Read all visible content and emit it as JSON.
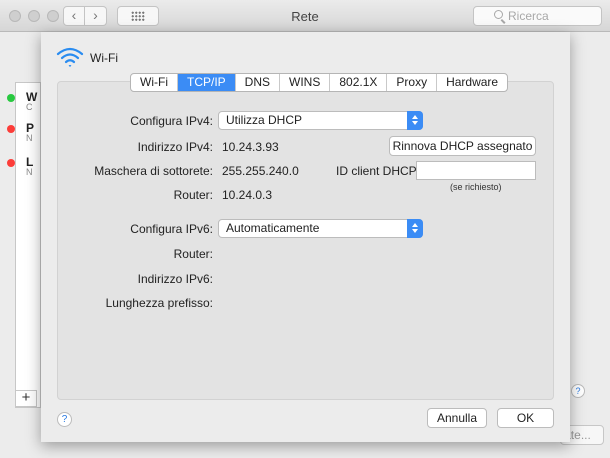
{
  "window": {
    "title": "Rete",
    "search_placeholder": "Ricerca",
    "back_label": "‹",
    "forward_label": "›"
  },
  "background": {
    "items": [
      {
        "label": "W",
        "sub": "C",
        "status_color": "#28c940"
      },
      {
        "label": "P",
        "sub": "N",
        "status_color": "#fc3d39"
      },
      {
        "label": "L",
        "sub": "N",
        "status_color": "#fc3d39"
      }
    ],
    "add_label": "+",
    "help_label": "?",
    "button_label": "Avanzate..."
  },
  "sheet": {
    "title": "Wi-Fi",
    "tabs": [
      {
        "label": "Wi-Fi",
        "active": false
      },
      {
        "label": "TCP/IP",
        "active": true
      },
      {
        "label": "DNS",
        "active": false
      },
      {
        "label": "WINS",
        "active": false
      },
      {
        "label": "802.1X",
        "active": false
      },
      {
        "label": "Proxy",
        "active": false
      },
      {
        "label": "Hardware",
        "active": false
      }
    ],
    "ipv4": {
      "config_label": "Configura IPv4:",
      "config_value": "Utilizza DHCP",
      "address_label": "Indirizzo IPv4:",
      "address_value": "10.24.3.93",
      "renew_button": "Rinnova DHCP assegnato",
      "mask_label": "Maschera di sottorete:",
      "mask_value": "255.255.240.0",
      "client_id_label": "ID client DHCP:",
      "client_id_value": "",
      "client_id_note": "(se richiesto)",
      "router_label": "Router:",
      "router_value": "10.24.0.3"
    },
    "ipv6": {
      "config_label": "Configura IPv6:",
      "config_value": "Automaticamente",
      "router_label": "Router:",
      "router_value": "",
      "address_label": "Indirizzo IPv6:",
      "address_value": "",
      "prefix_label": "Lunghezza prefisso:",
      "prefix_value": ""
    },
    "help_label": "?",
    "cancel_label": "Annulla",
    "ok_label": "OK"
  },
  "colors": {
    "accent": "#3b8cf5",
    "green_status": "#28c940",
    "red_status": "#fc3d39"
  }
}
